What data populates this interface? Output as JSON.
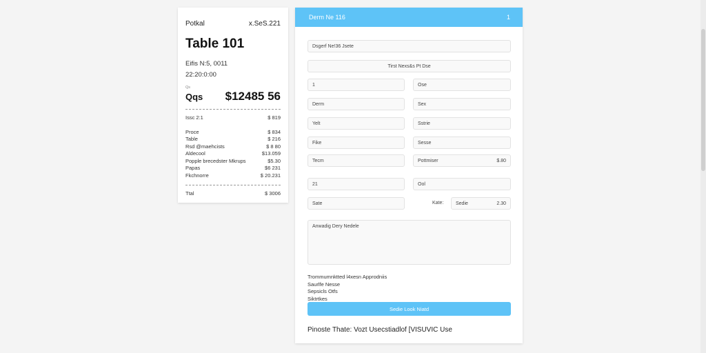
{
  "receipt": {
    "header_left": "Potkal",
    "header_right": "x.SeS.221",
    "title": "Table 101",
    "info_line1": "Eifis N:5, 0011",
    "info_line2": "22:20:0:00",
    "small_label": "Qs",
    "total_label": "Qqs",
    "total_amount": "$12485 56",
    "first_row": {
      "label": "Issc 2:1",
      "value": "$ 819"
    },
    "items": [
      {
        "label": "Proce",
        "value": "$ 834"
      },
      {
        "label": "Table",
        "value": "$ 216"
      },
      {
        "label": "Rsd @maehcists",
        "value": "$ 8 80"
      },
      {
        "label": "Aldecool",
        "value": "$13.059"
      },
      {
        "label": "Popple brecedster Mkrups",
        "value": "$5.30"
      },
      {
        "label": "Papas",
        "value": "$6 231"
      },
      {
        "label": "Fkchnorre",
        "value": "$ 20.231"
      }
    ],
    "final_row": {
      "label": "Ttal",
      "value": "$ 3006"
    }
  },
  "panel": {
    "header_title": "Derm Ne 116",
    "header_right": "1",
    "field_top": "Dsgerf Ne!36 Jsete",
    "field_button": "Tirst Nexs&s Pt Dse",
    "rows": [
      {
        "left": "1",
        "right": "Ose"
      },
      {
        "left": "Derm",
        "right": "Sex"
      },
      {
        "left": "Yelt",
        "right": "Sstrie"
      },
      {
        "left": "Fike",
        "right": "Sesse"
      }
    ],
    "team_field": "Tecm",
    "pollmiser_label": "Pottmiser",
    "pollmiser_value": "$.80",
    "row_21": "21",
    "row_ool": "Ool",
    "sate_field": "Sate",
    "kate_label": "Kate:",
    "sedie_label": "Sedie",
    "sedie_value": "2.30",
    "textarea_text": "Anwadig Dery Nedele",
    "notes": [
      "Trommumnktted l4xesn Approdniis",
      "Saurlfe Nesse",
      "Sepsicls Otfs",
      "Siktrtkes"
    ],
    "submit_label": "Sedie Look Niatd",
    "footer": "Pinoste Thate: Vozt Usecstiadlof [VISUVIC Use"
  },
  "colors": {
    "accent": "#5ec3f7",
    "background": "#f4f4f4"
  }
}
